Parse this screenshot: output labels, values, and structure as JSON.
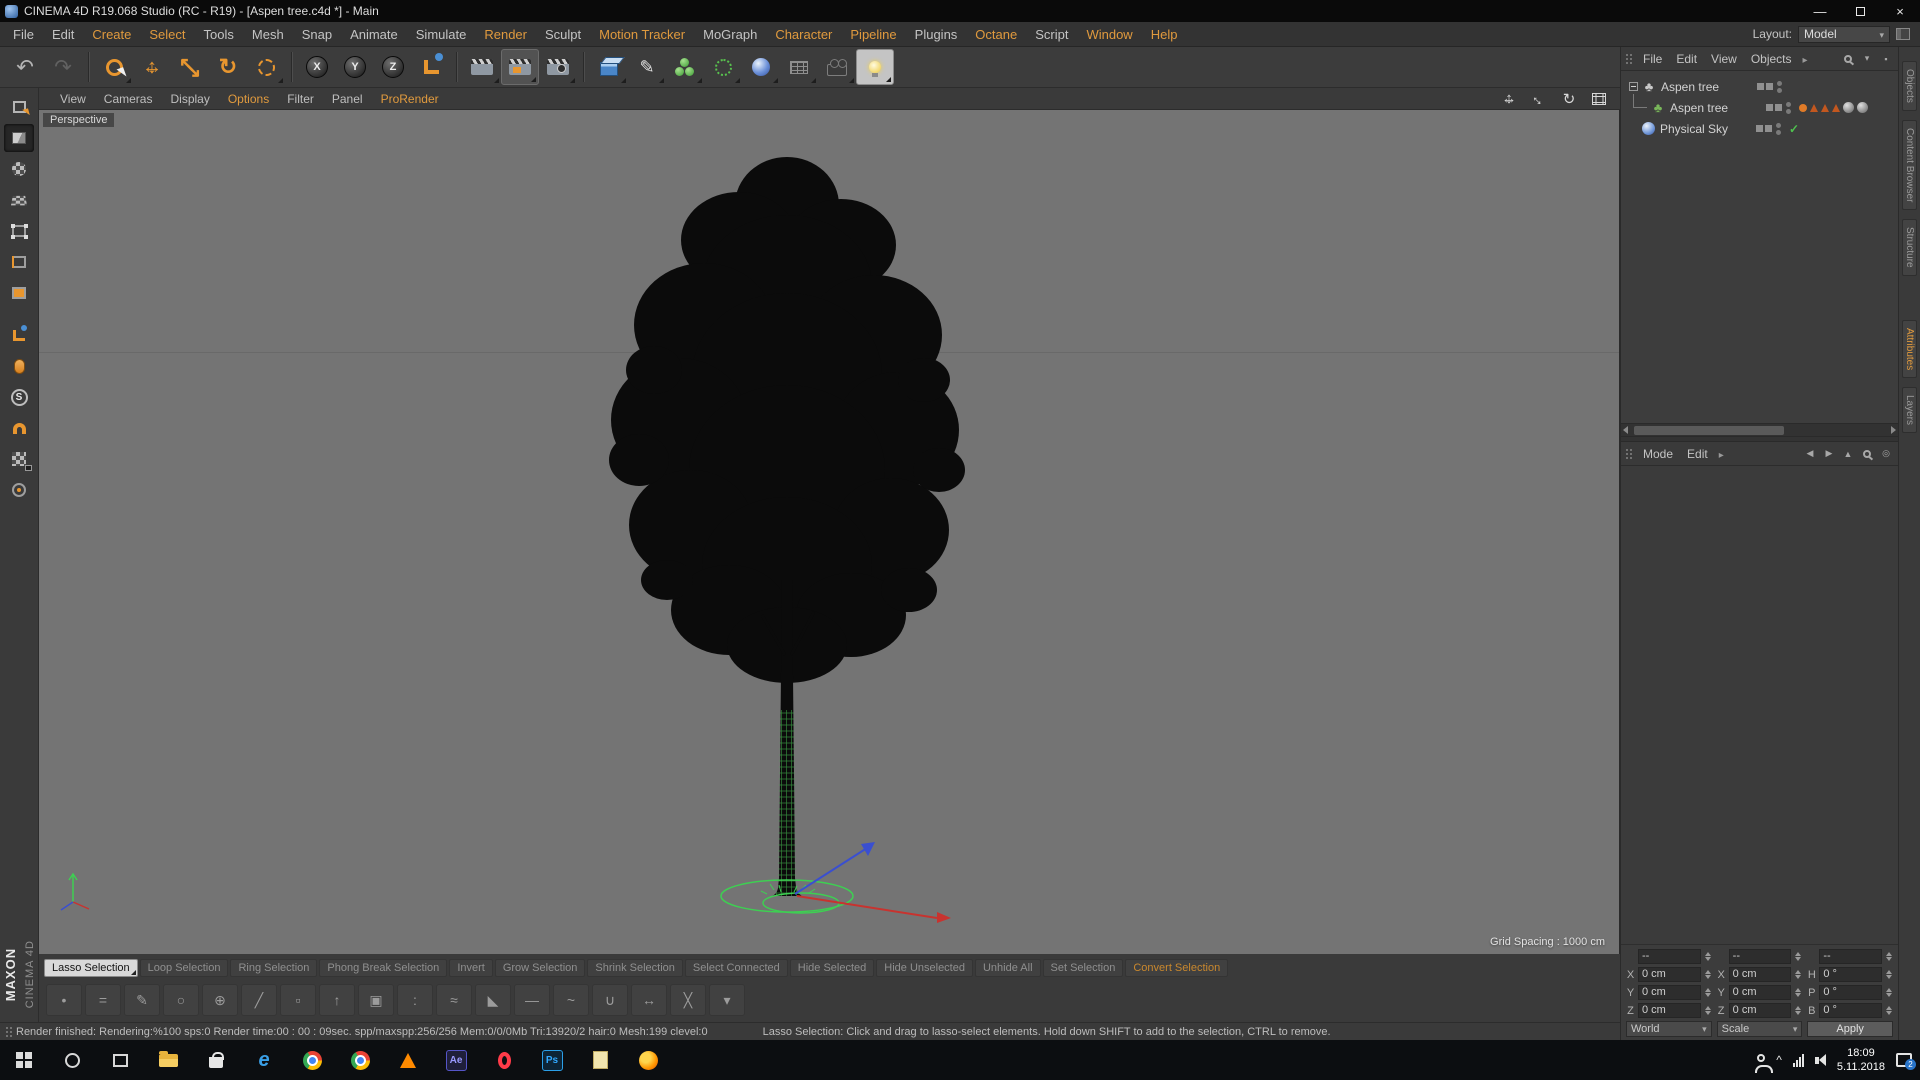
{
  "window": {
    "title": "CINEMA 4D R19.068 Studio (RC - R19) - [Aspen tree.c4d *] - Main",
    "minimize_glyph": "—",
    "close_glyph": "×"
  },
  "menubar": {
    "layout_label": "Layout:",
    "layout_value": "Model",
    "items": [
      {
        "label": "File"
      },
      {
        "label": "Edit"
      },
      {
        "label": "Create",
        "hl": true
      },
      {
        "label": "Select",
        "hl": true
      },
      {
        "label": "Tools"
      },
      {
        "label": "Mesh"
      },
      {
        "label": "Snap"
      },
      {
        "label": "Animate"
      },
      {
        "label": "Simulate"
      },
      {
        "label": "Render",
        "hl": true
      },
      {
        "label": "Sculpt"
      },
      {
        "label": "Motion Tracker",
        "hl": true
      },
      {
        "label": "MoGraph"
      },
      {
        "label": "Character",
        "hl": true
      },
      {
        "label": "Pipeline",
        "hl": true
      },
      {
        "label": "Plugins"
      },
      {
        "label": "Octane",
        "hl": true
      },
      {
        "label": "Script"
      },
      {
        "label": "Window",
        "hl": true
      },
      {
        "label": "Help",
        "hl": true
      }
    ]
  },
  "toolbar": {
    "icons": [
      {
        "name": "undo-icon",
        "glyph": "↶"
      },
      {
        "name": "redo-icon",
        "glyph": "↷"
      },
      {
        "name": "live-selection-icon"
      },
      {
        "name": "move-icon",
        "glyph": "↔",
        "glyph2": "↕"
      },
      {
        "name": "scale-icon",
        "glyph": "↖",
        "glyph2": "↘"
      },
      {
        "name": "rotate-icon",
        "glyph": "↻"
      },
      {
        "name": "last-tool-lasso-icon"
      },
      {
        "name": "x-axis-lock-icon",
        "glyph": "X"
      },
      {
        "name": "y-axis-lock-icon",
        "glyph": "Y"
      },
      {
        "name": "z-axis-lock-icon",
        "glyph": "Z"
      },
      {
        "name": "coordinate-system-icon"
      },
      {
        "name": "render-view-icon"
      },
      {
        "name": "render-picture-viewer-icon"
      },
      {
        "name": "render-settings-icon"
      },
      {
        "name": "primitive-cube-icon"
      },
      {
        "name": "pen-spline-icon",
        "glyph": "✎"
      },
      {
        "name": "mograph-icon"
      },
      {
        "name": "deformer-icon"
      },
      {
        "name": "environment-sky-icon"
      },
      {
        "name": "array-grid-icon"
      },
      {
        "name": "camera-icon"
      },
      {
        "name": "light-icon"
      }
    ]
  },
  "left_toolbar": {
    "icons": [
      {
        "name": "make-editable-icon"
      },
      {
        "name": "model-mode-icon",
        "active": true
      },
      {
        "name": "texture-mode-icon"
      },
      {
        "name": "workplane-mode-icon"
      },
      {
        "name": "points-mode-icon"
      },
      {
        "name": "edges-mode-icon"
      },
      {
        "name": "polygons-mode-icon"
      },
      {
        "name": "enable-axis-icon"
      },
      {
        "name": "tweak-mode-icon"
      },
      {
        "name": "snap-settings-icon",
        "glyph": "S"
      },
      {
        "name": "enable-snap-icon"
      },
      {
        "name": "lock-workplane-icon"
      },
      {
        "name": "quantize-icon"
      }
    ]
  },
  "viewport_menu": {
    "items": [
      {
        "label": "View"
      },
      {
        "label": "Cameras"
      },
      {
        "label": "Display"
      },
      {
        "label": "Options",
        "hl": true
      },
      {
        "label": "Filter"
      },
      {
        "label": "Panel"
      },
      {
        "label": "ProRender",
        "hl": true
      }
    ]
  },
  "viewport": {
    "view_label": "Perspective",
    "grid_spacing": "Grid Spacing : 1000 cm",
    "nav_icons": [
      {
        "name": "viewport-pan-icon",
        "glyph": "↔"
      },
      {
        "name": "viewport-zoom-icon",
        "glyph": "↔"
      },
      {
        "name": "viewport-rotate-icon",
        "glyph": "↻"
      },
      {
        "name": "viewport-toggle-icon",
        "glyph": ""
      }
    ]
  },
  "object_manager": {
    "menu": [
      "File",
      "Edit",
      "View",
      "Objects"
    ],
    "items": [
      {
        "label": "Aspen tree",
        "icon_glyph": "♣"
      },
      {
        "label": "Aspen tree",
        "icon_glyph": "♣"
      },
      {
        "label": "Physical Sky",
        "check": "✓"
      }
    ]
  },
  "attribute_manager": {
    "menu": [
      "Mode",
      "Edit"
    ]
  },
  "coordinates": {
    "header": [
      "--",
      "--",
      "--"
    ],
    "rows": [
      {
        "pl": "X",
        "pv": "0 cm",
        "sl": "X",
        "sv": "0 cm",
        "rl": "H",
        "rv": "0 °"
      },
      {
        "pl": "Y",
        "pv": "0 cm",
        "sl": "Y",
        "sv": "0 cm",
        "rl": "P",
        "rv": "0 °"
      },
      {
        "pl": "Z",
        "pv": "0 cm",
        "sl": "Z",
        "sv": "0 cm",
        "rl": "B",
        "rv": "0 °"
      }
    ],
    "footer": {
      "space": "World",
      "mode": "Scale",
      "apply": "Apply"
    }
  },
  "selection_toolbar": {
    "buttons": [
      {
        "label": "Lasso Selection",
        "active": true
      },
      {
        "label": "Loop Selection"
      },
      {
        "label": "Ring Selection"
      },
      {
        "label": "Phong Break Selection"
      },
      {
        "label": "Invert"
      },
      {
        "label": "Grow Selection"
      },
      {
        "label": "Shrink Selection"
      },
      {
        "label": "Select Connected"
      },
      {
        "label": "Hide Selected"
      },
      {
        "label": "Hide Unselected"
      },
      {
        "label": "Unhide All"
      },
      {
        "label": "Set Selection"
      },
      {
        "label": "Convert Selection",
        "highlight": true
      }
    ]
  },
  "mesh_tools": {
    "icons": [
      {
        "name": "create-point-icon",
        "glyph": "•"
      },
      {
        "name": "bridge-icon",
        "glyph": "="
      },
      {
        "name": "brush-icon",
        "glyph": "✎"
      },
      {
        "name": "close-polygon-hole-icon",
        "glyph": "○"
      },
      {
        "name": "connect-icon",
        "glyph": "⊕"
      },
      {
        "name": "knife-icon",
        "glyph": "╱"
      },
      {
        "name": "dissolve-icon",
        "glyph": "▫"
      },
      {
        "name": "extrude-icon",
        "glyph": "↑"
      },
      {
        "name": "extrude-inner-icon",
        "glyph": "▣"
      },
      {
        "name": "matrix-extrude-icon",
        "glyph": ":"
      },
      {
        "name": "smooth-shift-icon",
        "glyph": "≈"
      },
      {
        "name": "bevel-icon",
        "glyph": "◣"
      },
      {
        "name": "iron-icon",
        "glyph": "—"
      },
      {
        "name": "stitch-and-sew-icon",
        "glyph": "~"
      },
      {
        "name": "weld-icon",
        "glyph": "∪"
      },
      {
        "name": "slide-icon",
        "glyph": "↔"
      },
      {
        "name": "split-icon",
        "glyph": "╳"
      },
      {
        "name": "collapse-icon",
        "glyph": "▾"
      }
    ]
  },
  "statusbar": {
    "render_info": "Render finished: Rendering:%100 sps:0 Render time:00 : 00 : 09sec. spp/maxspp:256/256 Mem:0/0/0Mb Tri:13920/2 hair:0 Mesh:199 clevel:0",
    "tool_hint": "Lasso Selection: Click and drag to lasso-select elements. Hold down SHIFT to add to the selection, CTRL to remove."
  },
  "branding": {
    "maxon": "MAXON",
    "cinema": "CINEMA 4D"
  },
  "side_tabs": {
    "top": [
      {
        "label": "Objects"
      },
      {
        "label": "Content Browser"
      },
      {
        "label": "Structure"
      }
    ],
    "bottom": [
      {
        "label": "Attributes",
        "hl": true
      },
      {
        "label": "Layers"
      }
    ]
  },
  "taskbar": {
    "time": "18:09",
    "date": "5.11.2018",
    "badge": "2",
    "tray_chevron": "^",
    "ae_label": "Ae",
    "ps_label": "Ps",
    "icons": [
      "start-icon",
      "cortana-search-icon",
      "task-view-icon",
      "file-explorer-icon",
      "store-icon",
      "edge-icon",
      "chrome-icon",
      "chrome-profile-icon",
      "vlc-icon",
      "after-effects-icon",
      "opera-icon",
      "photoshop-icon",
      "documents-folder-icon",
      "firefox-icon"
    ]
  },
  "colors": {
    "accent_orange": "#e8962f",
    "viewport_bg": "#747474",
    "selection_green": "#3ecf52",
    "axis_red": "#c8332f",
    "axis_blue": "#3a4fd0",
    "taskbar_bg": "#0c0e11"
  }
}
